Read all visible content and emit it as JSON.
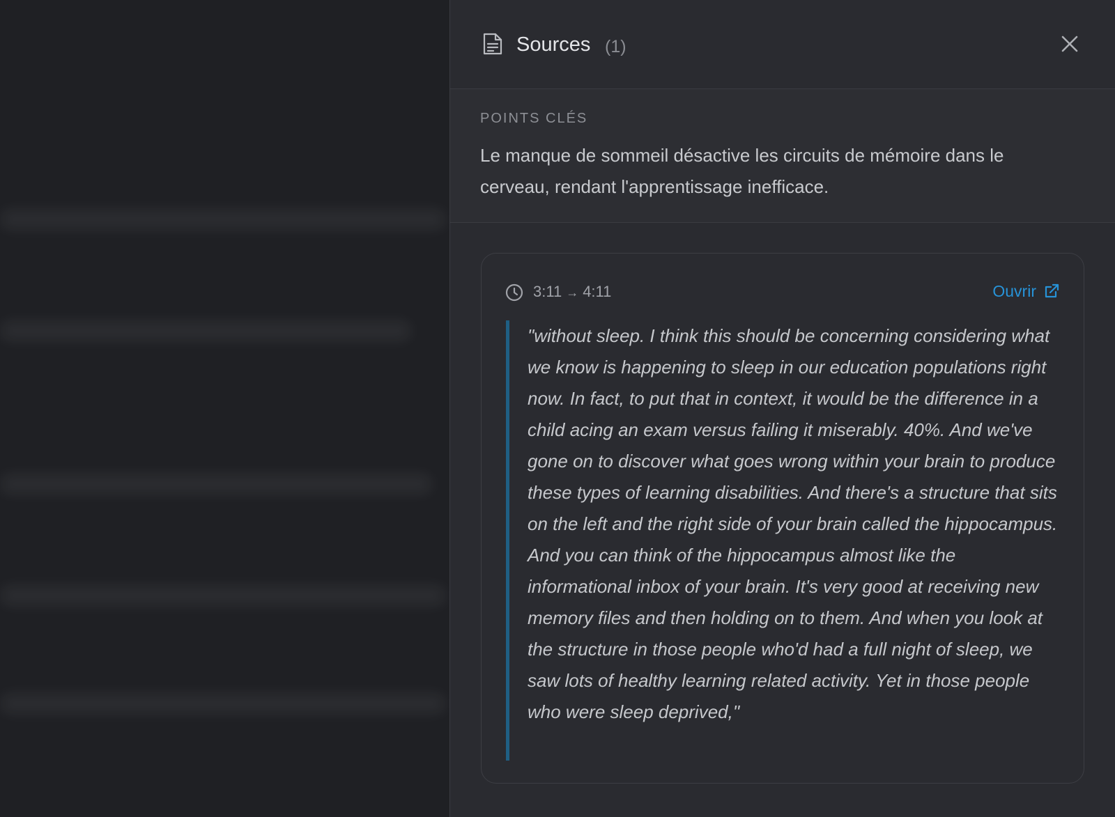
{
  "panel": {
    "title": "Sources",
    "count": "(1)"
  },
  "key_points": {
    "label": "POINTS CLÉS",
    "text": "Le manque de sommeil désactive les circuits de mémoire dans le cerveau, rendant l'apprentissage inefficace."
  },
  "source": {
    "time_start": "3:11",
    "time_arrow": "→",
    "time_end": "4:11",
    "open_label": "Ouvrir",
    "quote": "\"without sleep. I think this should be concerning considering what we know is happening to sleep in our education populations right now. In fact, to put that in context, it would be the difference in a child acing an exam versus failing it miserably. 40%. And we've gone on to discover what goes wrong within your brain to produce these types of learning disabilities. And there's a structure that sits on the left and the right side of your brain called the hippocampus. And you can think of the hippocampus almost like the informational inbox of your brain. It's very good at receiving new memory files and then holding on to them. And when you look at the structure in those people who'd had a full night of sleep, we saw lots of healthy learning related activity. Yet in those people who were sleep deprived,\""
  },
  "icons": {
    "header": "document-icon",
    "close": "close-icon",
    "time": "clock-icon",
    "open": "external-link-icon"
  },
  "colors": {
    "panel_bg": "#2a2b30",
    "accent_link": "#2793d8",
    "quote_bar": "#1f5f84"
  }
}
